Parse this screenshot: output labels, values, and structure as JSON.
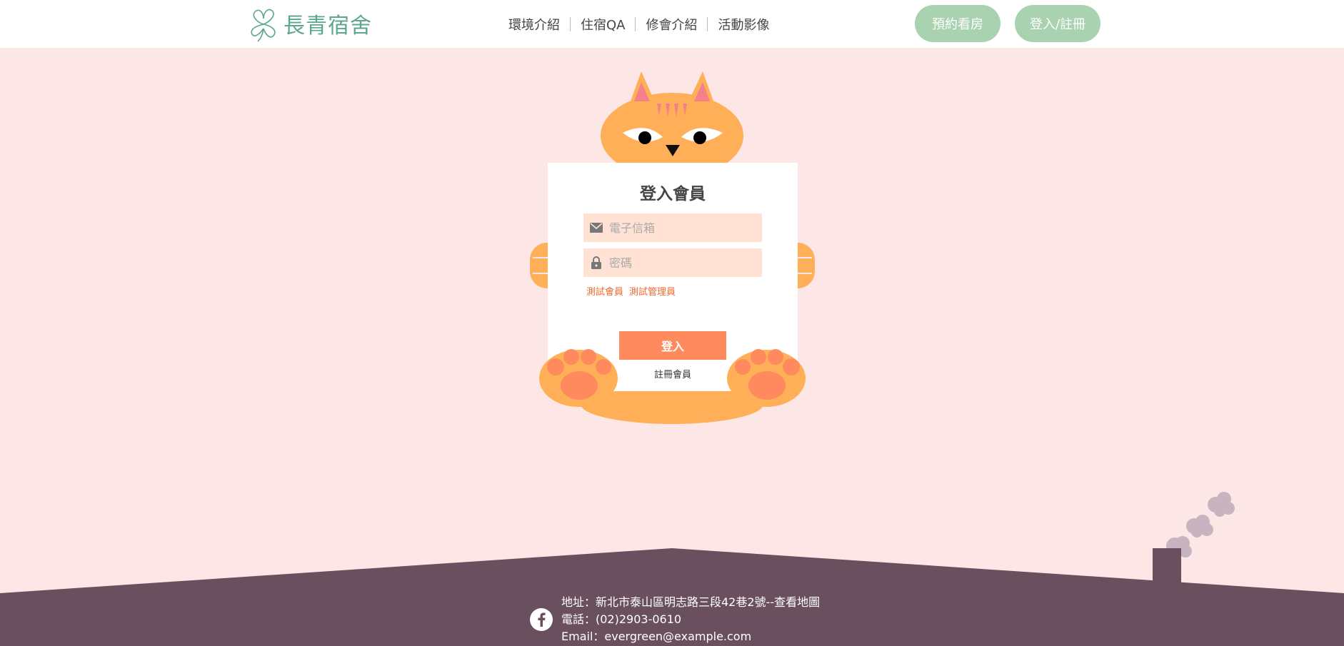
{
  "brand": {
    "name": "長青宿舍"
  },
  "nav": {
    "items": [
      {
        "label": "環境介紹"
      },
      {
        "label": "住宿QA"
      },
      {
        "label": "修會介紹"
      },
      {
        "label": "活動影像"
      }
    ],
    "reserve_label": "預約看房",
    "login_label": "登入/註冊"
  },
  "login": {
    "title": "登入會員",
    "email_placeholder": "電子信箱",
    "password_placeholder": "密碼",
    "test_member": "測試會員",
    "test_admin": "測試管理員",
    "submit_label": "登入",
    "register_label": "註冊會員"
  },
  "footer": {
    "address": "地址：新北市泰山區明志路三段42巷2號",
    "map_link": "--查看地圖",
    "phone": "電話：(02)2903-0610",
    "email": "Email：evergreen@example.com"
  },
  "colors": {
    "background": "#fde7e6",
    "accent_green": "#a9d2b0",
    "cat_orange": "#ffaf57",
    "submit": "#fe8a5e",
    "footer": "#6a4f5e"
  },
  "icons": [
    "clover-logo-icon",
    "envelope-icon",
    "lock-icon",
    "facebook-icon",
    "cat-illustration"
  ]
}
